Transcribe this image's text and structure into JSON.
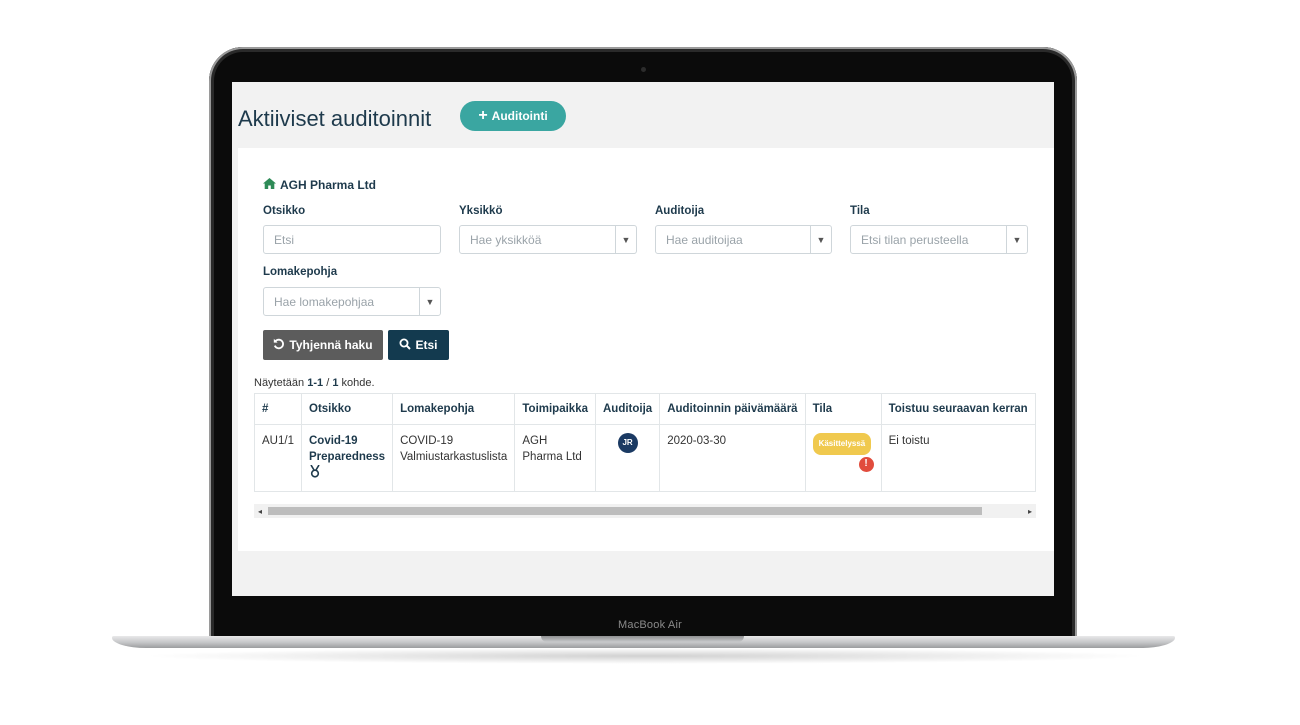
{
  "device": {
    "label": "MacBook Air"
  },
  "page": {
    "title": "Aktiiviset auditoinnit",
    "add_button": {
      "icon": "plus-icon",
      "label": "Auditointi"
    }
  },
  "filters": {
    "company": {
      "icon": "home-icon",
      "name": "AGH Pharma Ltd"
    },
    "otsikko": {
      "label": "Otsikko",
      "placeholder": "Etsi"
    },
    "yksikko": {
      "label": "Yksikkö",
      "placeholder": "Hae yksikköä"
    },
    "auditoija": {
      "label": "Auditoija",
      "placeholder": "Hae auditoijaa"
    },
    "tila": {
      "label": "Tila",
      "placeholder": "Etsi tilan perusteella"
    },
    "lomakepohja": {
      "label": "Lomakepohja",
      "placeholder": "Hae lomakepohjaa"
    },
    "clear_button": {
      "icon": "undo-icon",
      "label": "Tyhjennä haku"
    },
    "search_button": {
      "icon": "search-icon",
      "label": "Etsi"
    }
  },
  "results": {
    "prefix": "Näytetään",
    "range": "1-1",
    "separator": "/",
    "total": "1",
    "suffix": "kohde."
  },
  "table": {
    "columns": [
      "#",
      "Otsikko",
      "Lomakepohja",
      "Toimipaikka",
      "Auditoija",
      "Auditoinnin päivämäärä",
      "Tila",
      "Toistuu seuraavan kerran"
    ],
    "rows": [
      {
        "id": "AU1/1",
        "title": "Covid-19 Preparedness",
        "title_icon": "award-icon",
        "template": "COVID-19 Valmiustarkastuslista",
        "location": "AGH Pharma Ltd",
        "auditor_initials": "JR",
        "date": "2020-03-30",
        "status": "Käsittelyssä",
        "status_color": "#f0c94e",
        "alert_icon": "exclamation-icon",
        "repeat": "Ei toistu"
      }
    ]
  }
}
